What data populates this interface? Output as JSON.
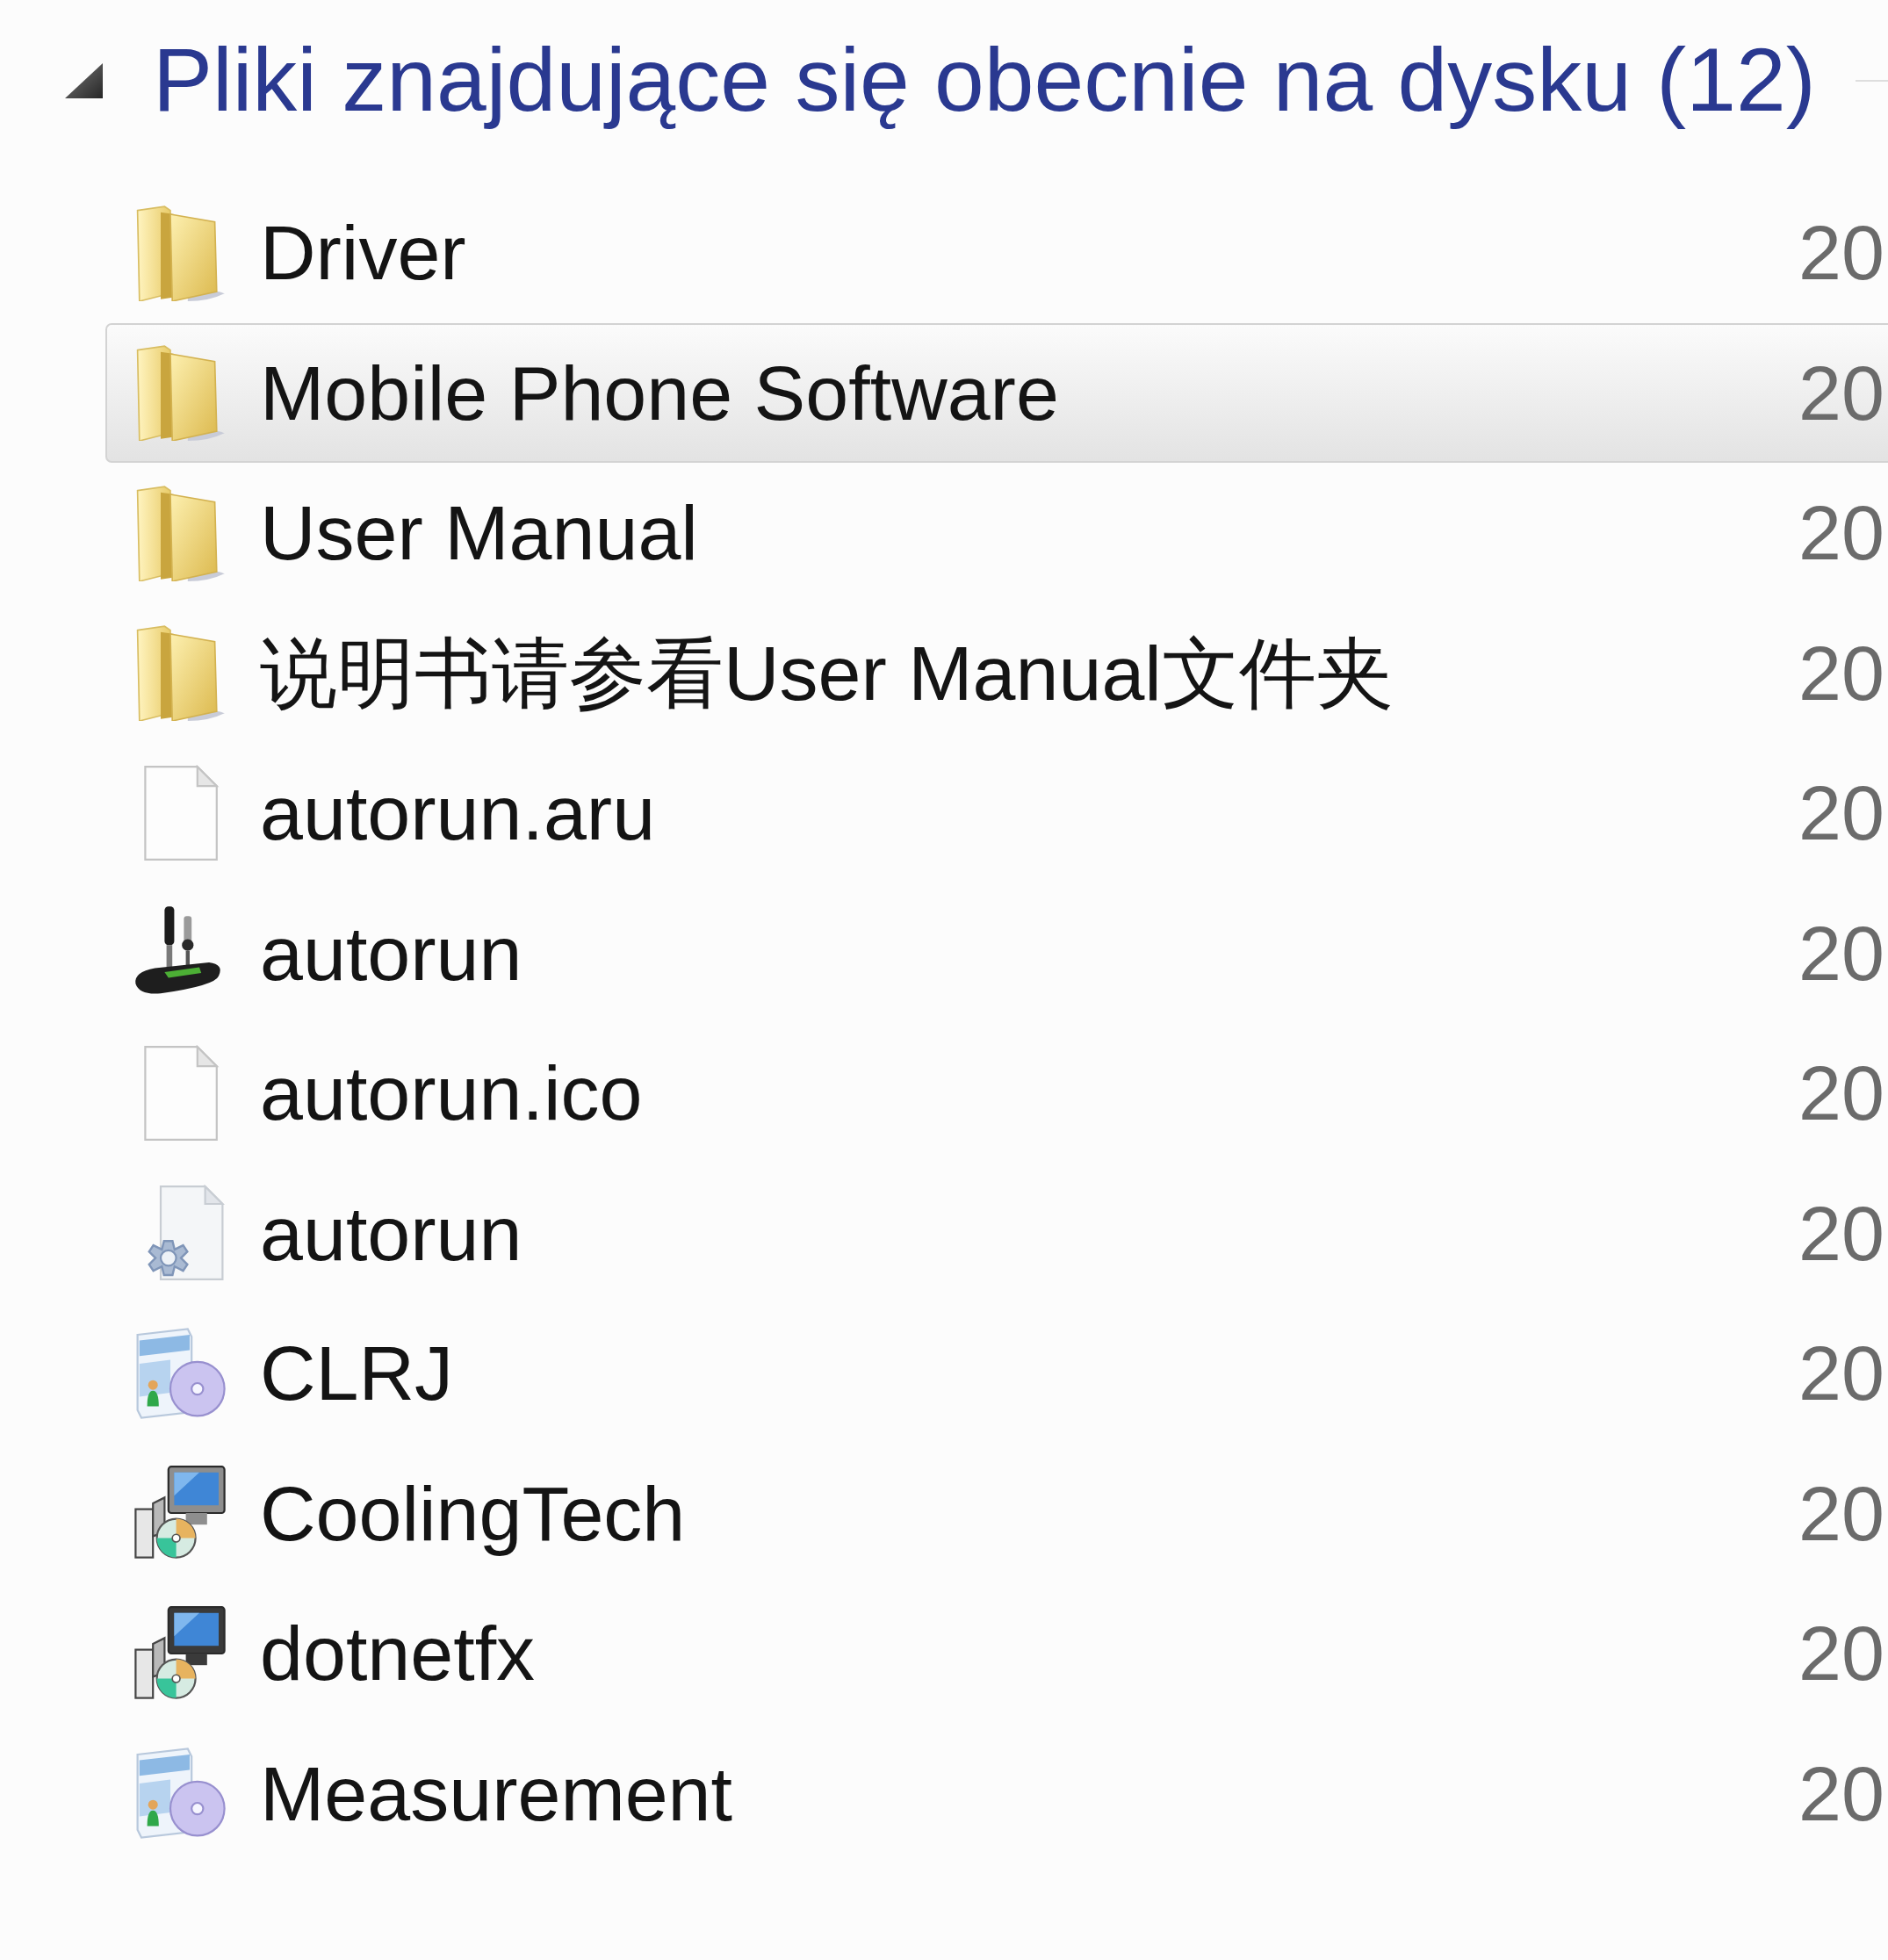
{
  "group": {
    "title": "Pliki znajdujące się obecnie na dysku (12)",
    "expanded": true
  },
  "files": [
    {
      "name": "Driver",
      "kind": "folder",
      "column_2": "20",
      "selected": false
    },
    {
      "name": "Mobile Phone Software",
      "kind": "folder",
      "column_2": "20",
      "selected": true
    },
    {
      "name": "User Manual",
      "kind": "folder",
      "column_2": "20",
      "selected": false
    },
    {
      "name": "说明书请参看User Manual文件夹",
      "kind": "folder",
      "column_2": "20",
      "selected": false
    },
    {
      "name": "autorun.aru",
      "kind": "file",
      "column_2": "20",
      "selected": false
    },
    {
      "name": "autorun",
      "kind": "program",
      "column_2": "20",
      "selected": false
    },
    {
      "name": "autorun.ico",
      "kind": "file",
      "column_2": "20",
      "selected": false
    },
    {
      "name": "autorun",
      "kind": "settings",
      "column_2": "20",
      "selected": false
    },
    {
      "name": "CLRJ",
      "kind": "installer",
      "column_2": "20",
      "selected": false
    },
    {
      "name": "CoolingTech",
      "kind": "setup",
      "column_2": "20",
      "selected": false
    },
    {
      "name": "dotnetfx",
      "kind": "setup",
      "column_2": "20",
      "selected": false
    },
    {
      "name": "Measurement",
      "kind": "installer",
      "column_2": "20",
      "selected": false
    }
  ]
}
